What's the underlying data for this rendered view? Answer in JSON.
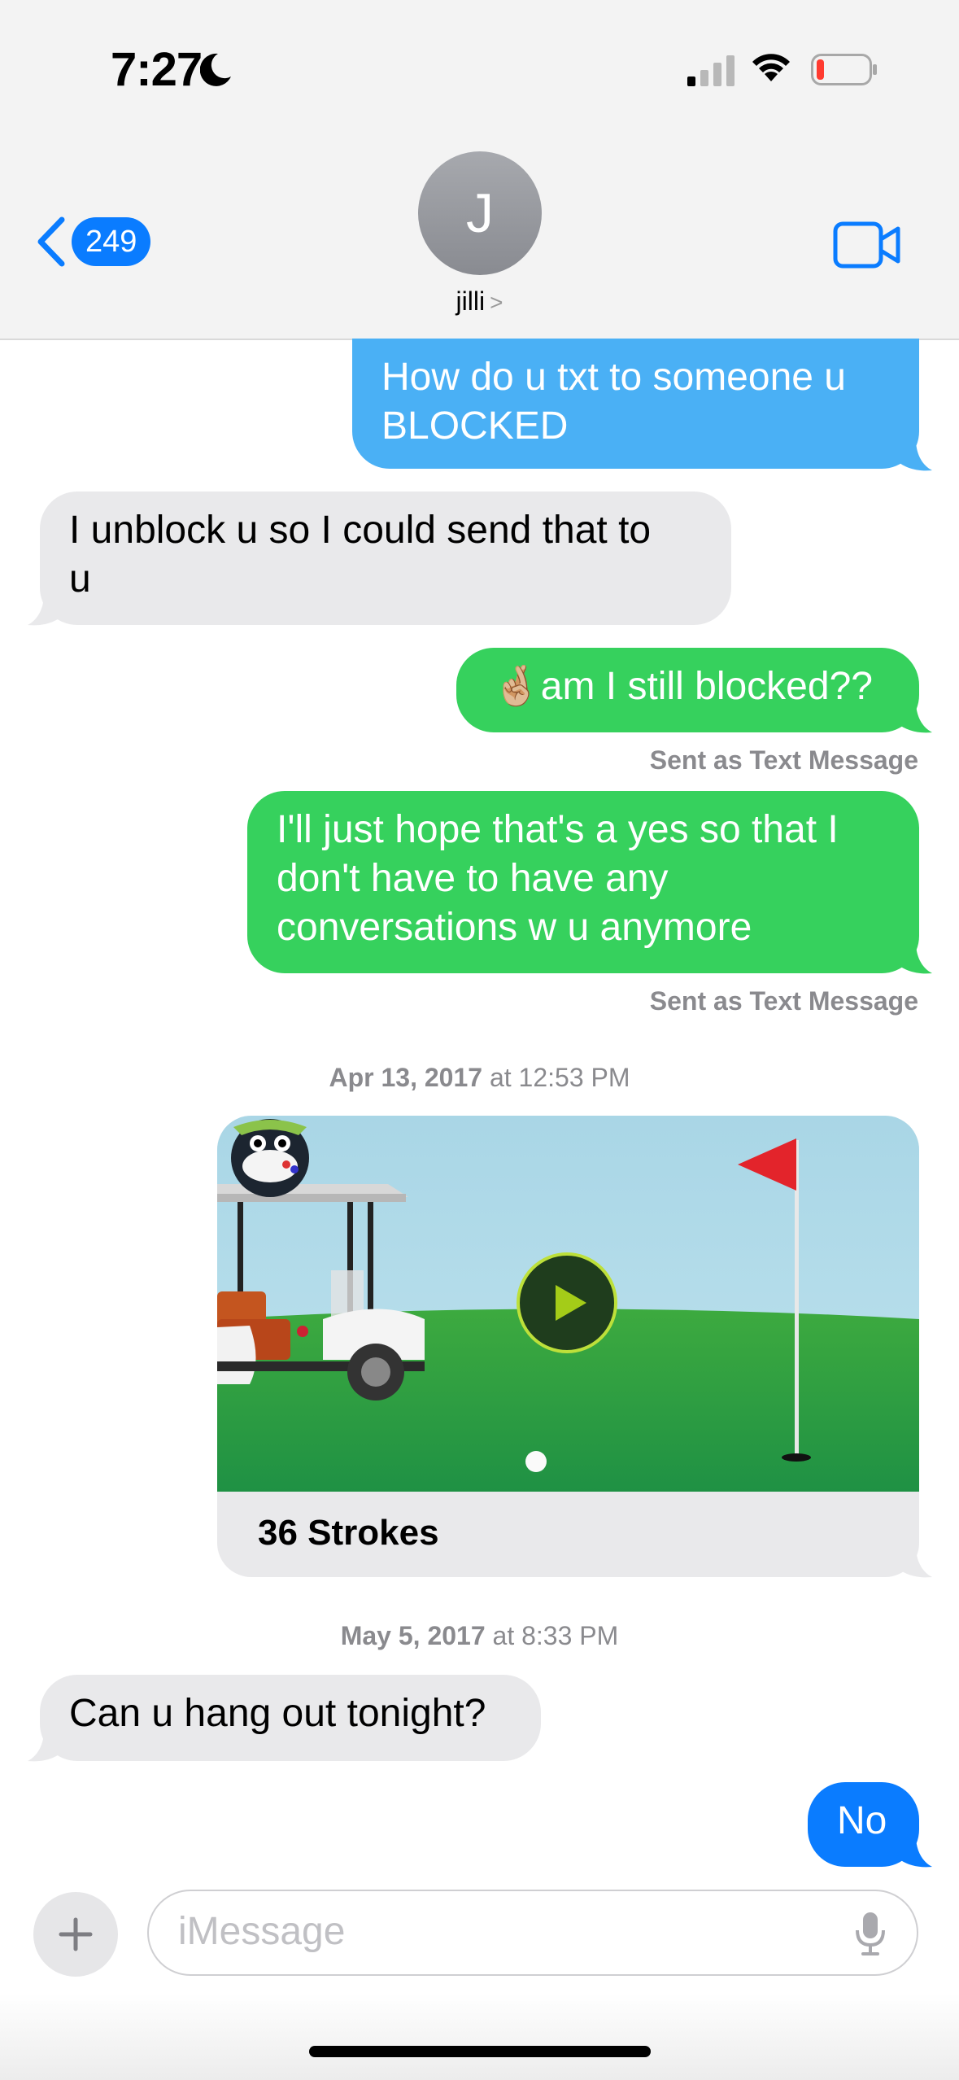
{
  "status_bar": {
    "time": "7:27"
  },
  "nav": {
    "back_count": "249",
    "avatar_initial": "J",
    "contact_name": "jilli",
    "contact_chevron": ">"
  },
  "messages": [
    {
      "side": "sent",
      "type": "sms-blue",
      "text_lines": [
        "How do u txt to someone u",
        "BLOCKED"
      ]
    },
    {
      "side": "received",
      "text_lines": [
        "I unblock u so I could send that to",
        "u"
      ]
    },
    {
      "side": "sent",
      "type": "sms",
      "text": "🤞🏼am I still blocked??",
      "note": "Sent as Text Message"
    },
    {
      "side": "sent",
      "type": "sms",
      "text_lines": [
        "I'll just hope that's a yes so that I",
        "don't have to have any",
        "conversations w u anymore"
      ],
      "note": "Sent as Text Message"
    }
  ],
  "timestamp_1": {
    "date": "Apr 13, 2017",
    "time": "at 12:53 PM"
  },
  "game_card": {
    "caption": "36 Strokes"
  },
  "timestamp_2": {
    "date": "May 5, 2017",
    "time": "at 8:33 PM"
  },
  "messages_2": [
    {
      "side": "received",
      "text": "Can u hang out tonight?"
    },
    {
      "side": "sent",
      "type": "imessage",
      "text": "No"
    }
  ],
  "composer": {
    "placeholder": "iMessage"
  },
  "colors": {
    "imessage_blue": "#0a7cff",
    "sms_green": "#36d15d",
    "faded_blue": "#4ab0f5",
    "received_gray": "#e9e9eb"
  },
  "icons": [
    "moon-icon",
    "cellular-signal-icon",
    "wifi-icon",
    "battery-icon",
    "back-chevron-icon",
    "video-camera-icon",
    "plus-icon",
    "microphone-icon",
    "play-icon"
  ]
}
